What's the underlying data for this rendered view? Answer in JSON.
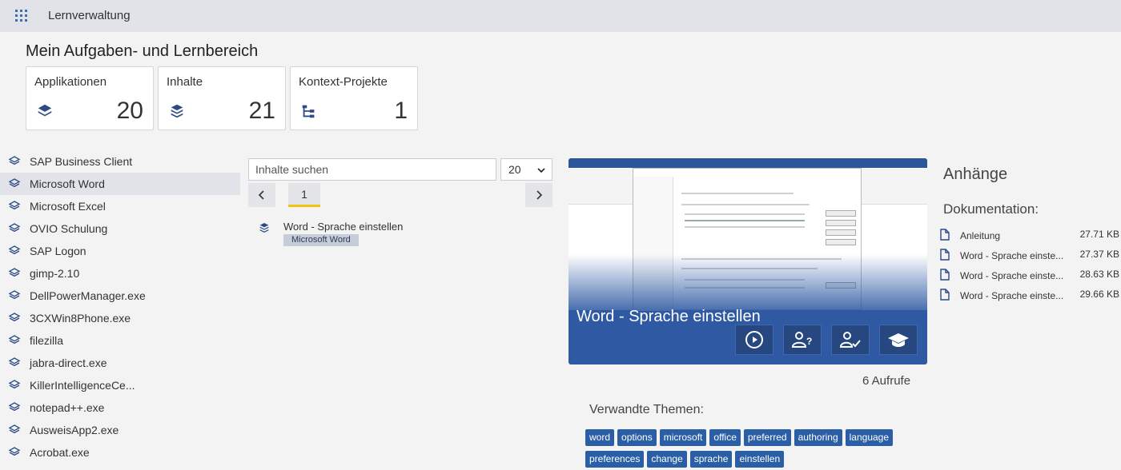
{
  "topbar": {
    "app_title": "Lernverwaltung"
  },
  "page_title": "Mein Aufgaben- und Lernbereich",
  "stats": [
    {
      "label": "Applikationen",
      "value": "20",
      "icon": "layers-icon"
    },
    {
      "label": "Inhalte",
      "value": "21",
      "icon": "stack-icon"
    },
    {
      "label": "Kontext-Projekte",
      "value": "1",
      "icon": "sitemap-icon"
    }
  ],
  "applications": [
    {
      "label": "SAP Business Client",
      "active": false
    },
    {
      "label": "Microsoft Word",
      "active": true
    },
    {
      "label": "Microsoft Excel",
      "active": false
    },
    {
      "label": "OVIO Schulung",
      "active": false
    },
    {
      "label": "SAP Logon",
      "active": false
    },
    {
      "label": "gimp-2.10",
      "active": false
    },
    {
      "label": "DellPowerManager.exe",
      "active": false
    },
    {
      "label": "3CXWin8Phone.exe",
      "active": false
    },
    {
      "label": "filezilla",
      "active": false
    },
    {
      "label": "jabra-direct.exe",
      "active": false
    },
    {
      "label": "KillerIntelligenceCe...",
      "active": false
    },
    {
      "label": "notepad++.exe",
      "active": false
    },
    {
      "label": "AusweisApp2.exe",
      "active": false
    },
    {
      "label": "Acrobat.exe",
      "active": false
    }
  ],
  "search": {
    "placeholder": "Inhalte suchen",
    "value": ""
  },
  "page_size": {
    "selected": "20"
  },
  "pager": {
    "current": "1"
  },
  "content_items": [
    {
      "title": "Word - Sprache einstellen",
      "tag": "Microsoft Word"
    }
  ],
  "preview": {
    "title": "Word - Sprache einstellen",
    "actions": [
      "play-icon",
      "user-question-icon",
      "user-check-icon",
      "graduation-cap-icon"
    ]
  },
  "views": "6 Aufrufe",
  "related": {
    "title": "Verwandte Themen:",
    "tags": [
      "word",
      "options",
      "microsoft",
      "office",
      "preferred",
      "authoring",
      "language",
      "preferences",
      "change",
      "sprache",
      "einstellen"
    ]
  },
  "attachments": {
    "title": "Anhänge",
    "section": "Dokumentation:",
    "files": [
      {
        "name": "Anleitung",
        "size": "27.71 KB"
      },
      {
        "name": "Word - Sprache einste...",
        "size": "27.37 KB"
      },
      {
        "name": "Word - Sprache einste...",
        "size": "28.63 KB"
      },
      {
        "name": "Word - Sprache einste...",
        "size": "29.66 KB"
      }
    ]
  },
  "colors": {
    "accent": "#2a5fa5",
    "preview_bg": "#2f5aa3",
    "pager_active": "#f1c40f",
    "topbar": "#e1e3e8"
  }
}
